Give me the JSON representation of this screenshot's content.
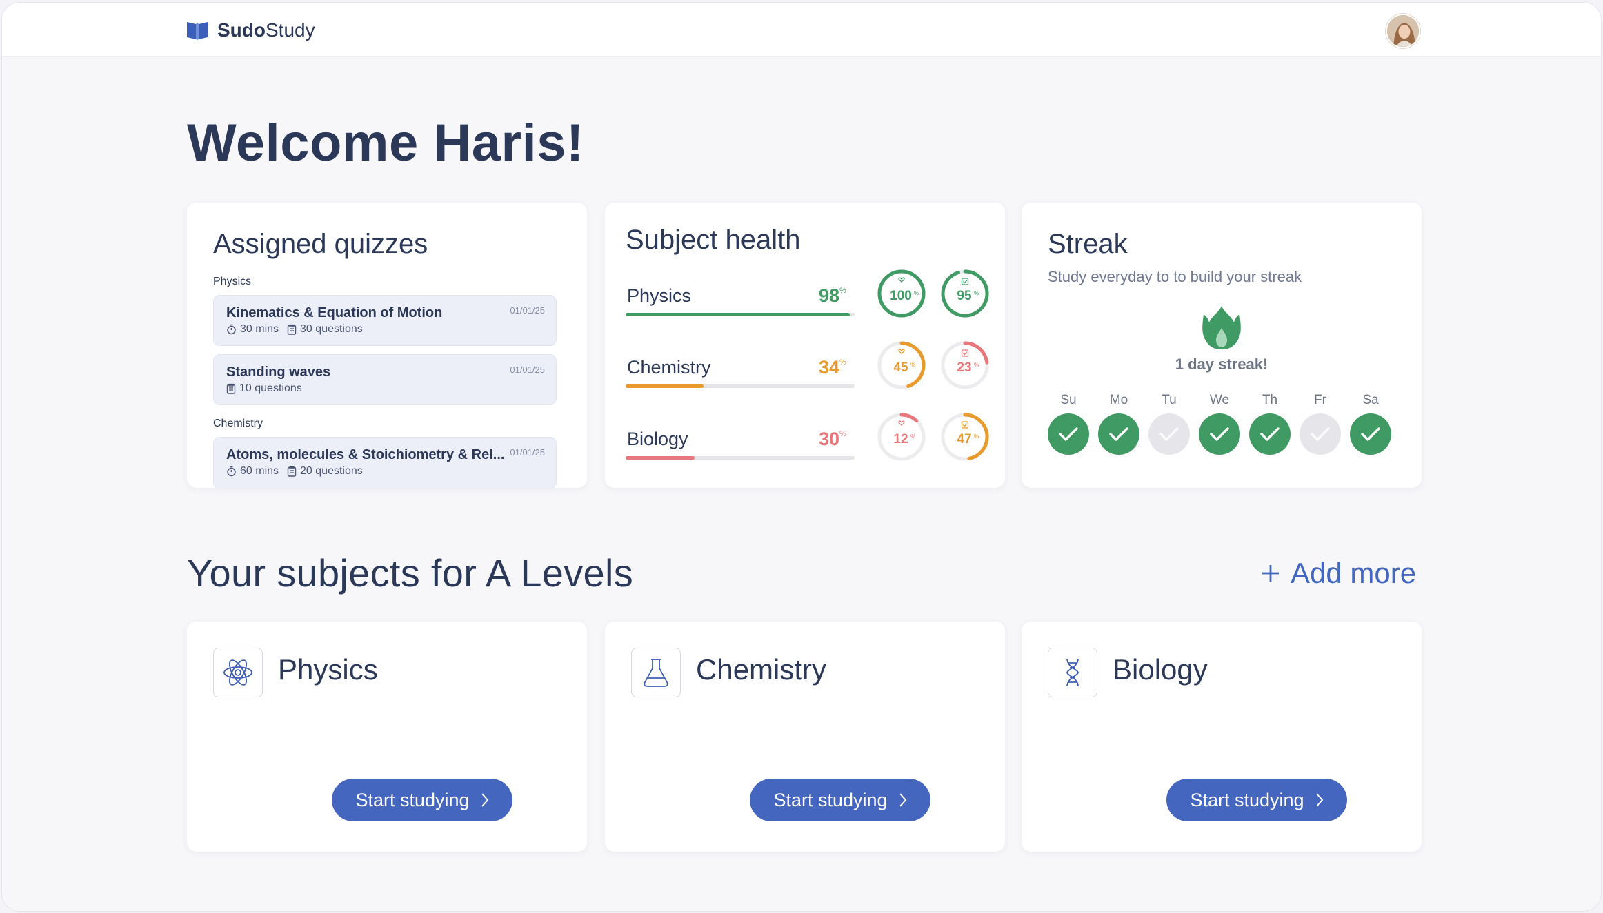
{
  "app": {
    "logo_bold": "Sudo",
    "logo_light": "Study"
  },
  "welcome": "Welcome Haris!",
  "quizzes": {
    "title": "Assigned quizzes",
    "groups": [
      {
        "label": "Physics",
        "items": [
          {
            "name": "Kinematics & Equation of Motion",
            "date": "01/01/25",
            "duration": "30 mins",
            "questions": "30 questions"
          },
          {
            "name": "Standing waves",
            "date": "01/01/25",
            "questions": "10 questions"
          }
        ]
      },
      {
        "label": "Chemistry",
        "items": [
          {
            "name": "Atoms, molecules & Stoichiometry & Rel...",
            "date": "01/01/25",
            "duration": "60 mins",
            "questions": "20 questions"
          }
        ]
      }
    ]
  },
  "health": {
    "title": "Subject health",
    "pct_sign": "%",
    "subjects": [
      {
        "name": "Physics",
        "pct": "98",
        "bar": 0.98,
        "color": "#3f9a63",
        "ring1": "100",
        "ring1_value": 1.0,
        "ring1_color": "#3f9a63",
        "ring2": "95",
        "ring2_value": 0.95,
        "ring2_color": "#3f9a63"
      },
      {
        "name": "Chemistry",
        "pct": "34",
        "bar": 0.34,
        "color": "#e99a2c",
        "ring1": "45",
        "ring1_value": 0.45,
        "ring1_color": "#e99a2c",
        "ring2": "23",
        "ring2_value": 0.23,
        "ring2_color": "#e9767a"
      },
      {
        "name": "Biology",
        "pct": "30",
        "bar": 0.3,
        "color": "#e9767a",
        "ring1": "12",
        "ring1_value": 0.12,
        "ring1_color": "#e9767a",
        "ring2": "47",
        "ring2_value": 0.47,
        "ring2_color": "#e99a2c"
      }
    ]
  },
  "streak": {
    "title": "Streak",
    "subtitle": "Study everyday to to build your streak",
    "count_text": "1 day streak!",
    "days": [
      {
        "label": "Su",
        "done": true
      },
      {
        "label": "Mo",
        "done": true
      },
      {
        "label": "Tu",
        "done": false
      },
      {
        "label": "We",
        "done": true
      },
      {
        "label": "Th",
        "done": true
      },
      {
        "label": "Fr",
        "done": false
      },
      {
        "label": "Sa",
        "done": true
      }
    ]
  },
  "subjects_section": {
    "title": "Your subjects for A Levels",
    "add_more": "Add more",
    "cards": [
      {
        "name": "Physics",
        "icon": "atom-icon",
        "button": "Start studying"
      },
      {
        "name": "Chemistry",
        "icon": "flask-icon",
        "button": "Start studying"
      },
      {
        "name": "Biology",
        "icon": "dna-icon",
        "button": "Start studying"
      }
    ]
  },
  "colors": {
    "accent": "#4566bf",
    "green": "#3f9a63",
    "orange": "#e99a2c",
    "red": "#e9767a",
    "text": "#2c3858"
  }
}
